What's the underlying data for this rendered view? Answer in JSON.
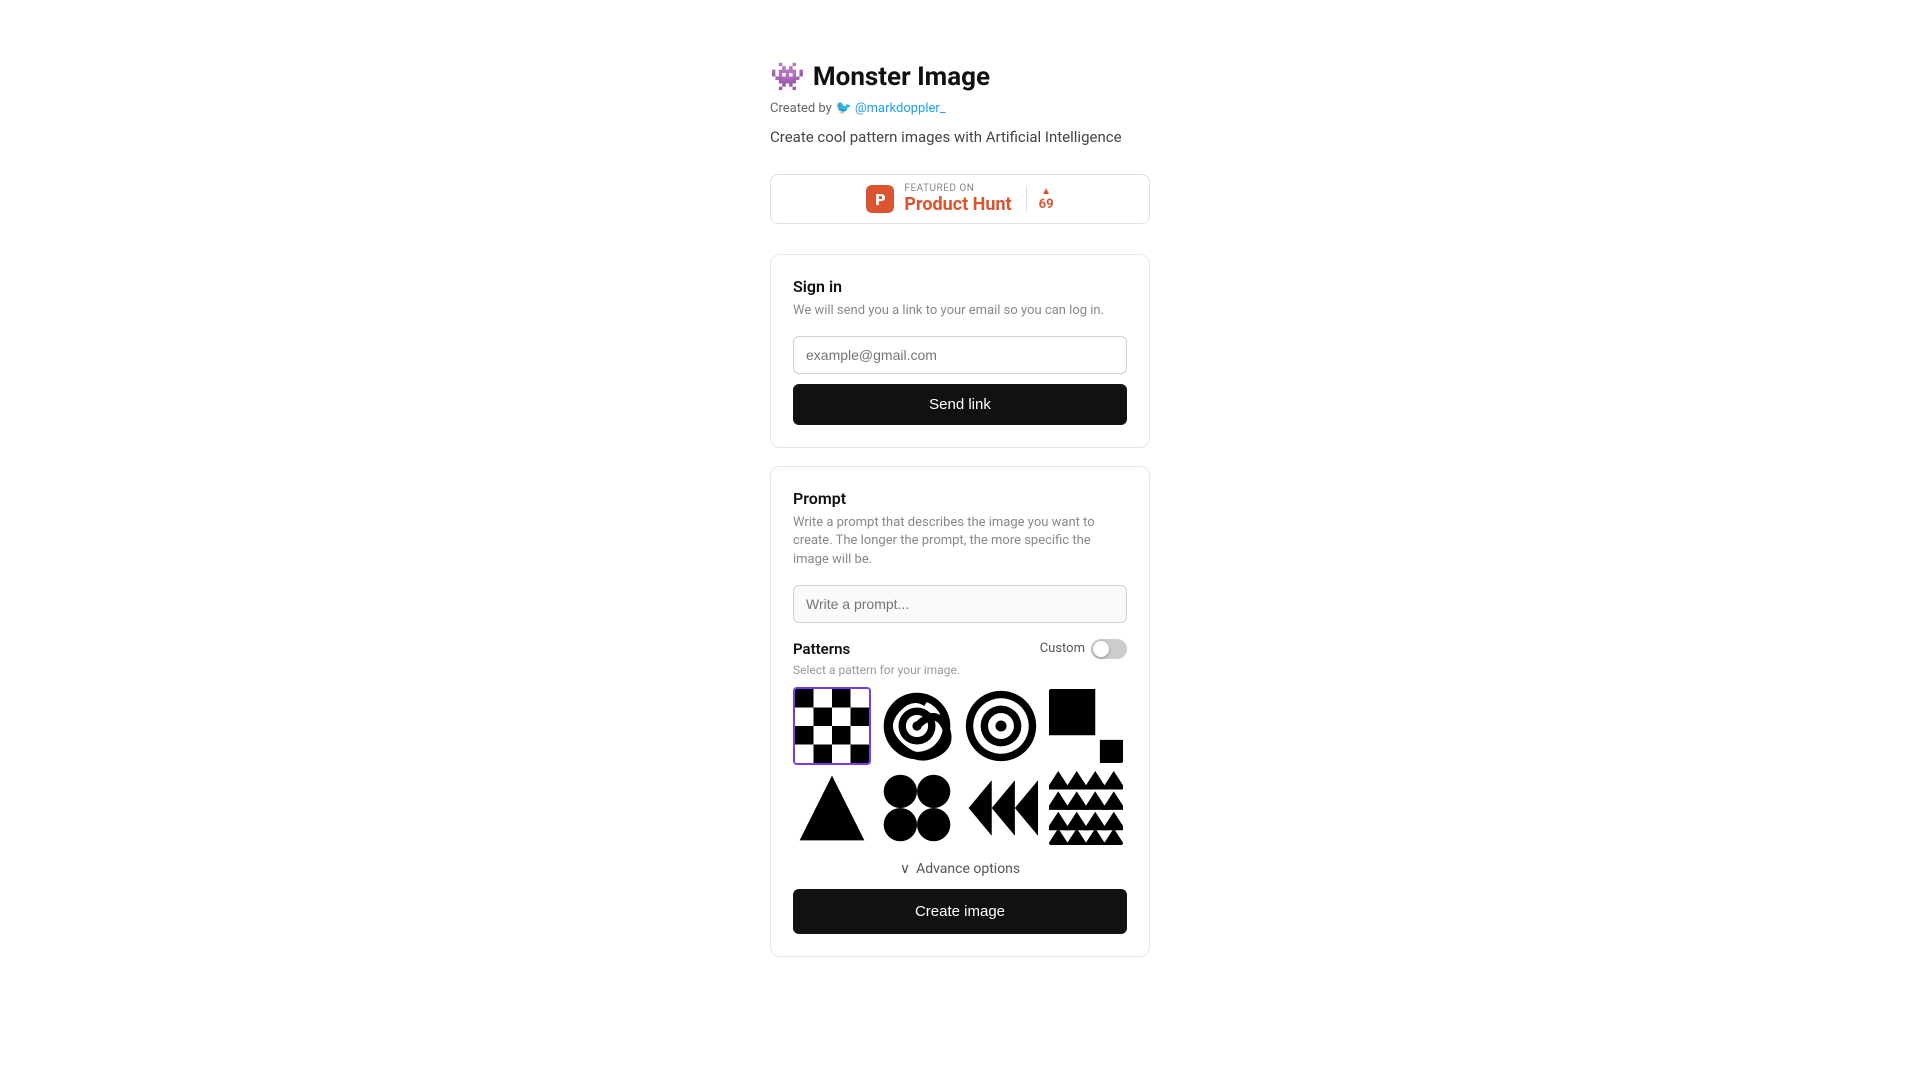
{
  "app": {
    "title": "Monster Image",
    "tagline": "Create cool pattern images with Artificial Intelligence"
  },
  "creator": {
    "label": "Created by",
    "twitter_handle": "@markdoppler_"
  },
  "product_hunt": {
    "featured_text": "FEATURED ON",
    "name": "Product Hunt",
    "votes": "69",
    "arrow": "▲"
  },
  "sign_in": {
    "title": "Sign in",
    "description": "We will send you a link to your email so you can log in.",
    "email_placeholder": "example@gmail.com",
    "send_button_label": "Send link"
  },
  "prompt": {
    "title": "Prompt",
    "description": "Write a prompt that describes the image you want to create. The longer the prompt, the more specific the image will be.",
    "placeholder": "Write a prompt...",
    "patterns_title": "Patterns",
    "custom_label": "Custom",
    "patterns_desc": "Select a pattern for your image.",
    "advance_options_label": "Advance options",
    "create_button_label": "Create image"
  },
  "icons": {
    "monster_emoji": "👾",
    "twitter_bird": "🐦",
    "chevron_down": "∨"
  }
}
